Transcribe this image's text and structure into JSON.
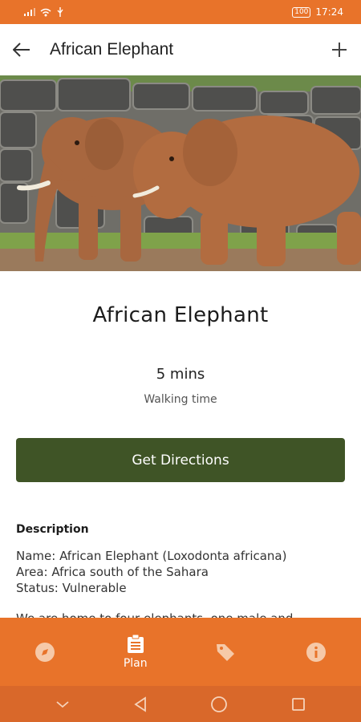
{
  "status_bar": {
    "battery": "100",
    "time": "17:24"
  },
  "app_bar": {
    "title": "African Elephant"
  },
  "detail": {
    "name": "African Elephant",
    "walk_value": "5 mins",
    "walk_label": "Walking time",
    "directions_label": "Get Directions",
    "description_heading": "Description",
    "description_lines": [
      "Name: African Elephant (Loxodonta africana)",
      "Area: Africa south of the Sahara",
      "Status: Vulnerable"
    ],
    "description_more": "We are home to four elephants, one male and"
  },
  "tabs": [
    {
      "icon": "compass-icon",
      "label": ""
    },
    {
      "icon": "clipboard-list-icon",
      "label": "Plan",
      "active": true
    },
    {
      "icon": "tag-icon",
      "label": ""
    },
    {
      "icon": "info-icon",
      "label": ""
    }
  ],
  "colors": {
    "accent": "#e8732a",
    "button": "#3f5426"
  }
}
